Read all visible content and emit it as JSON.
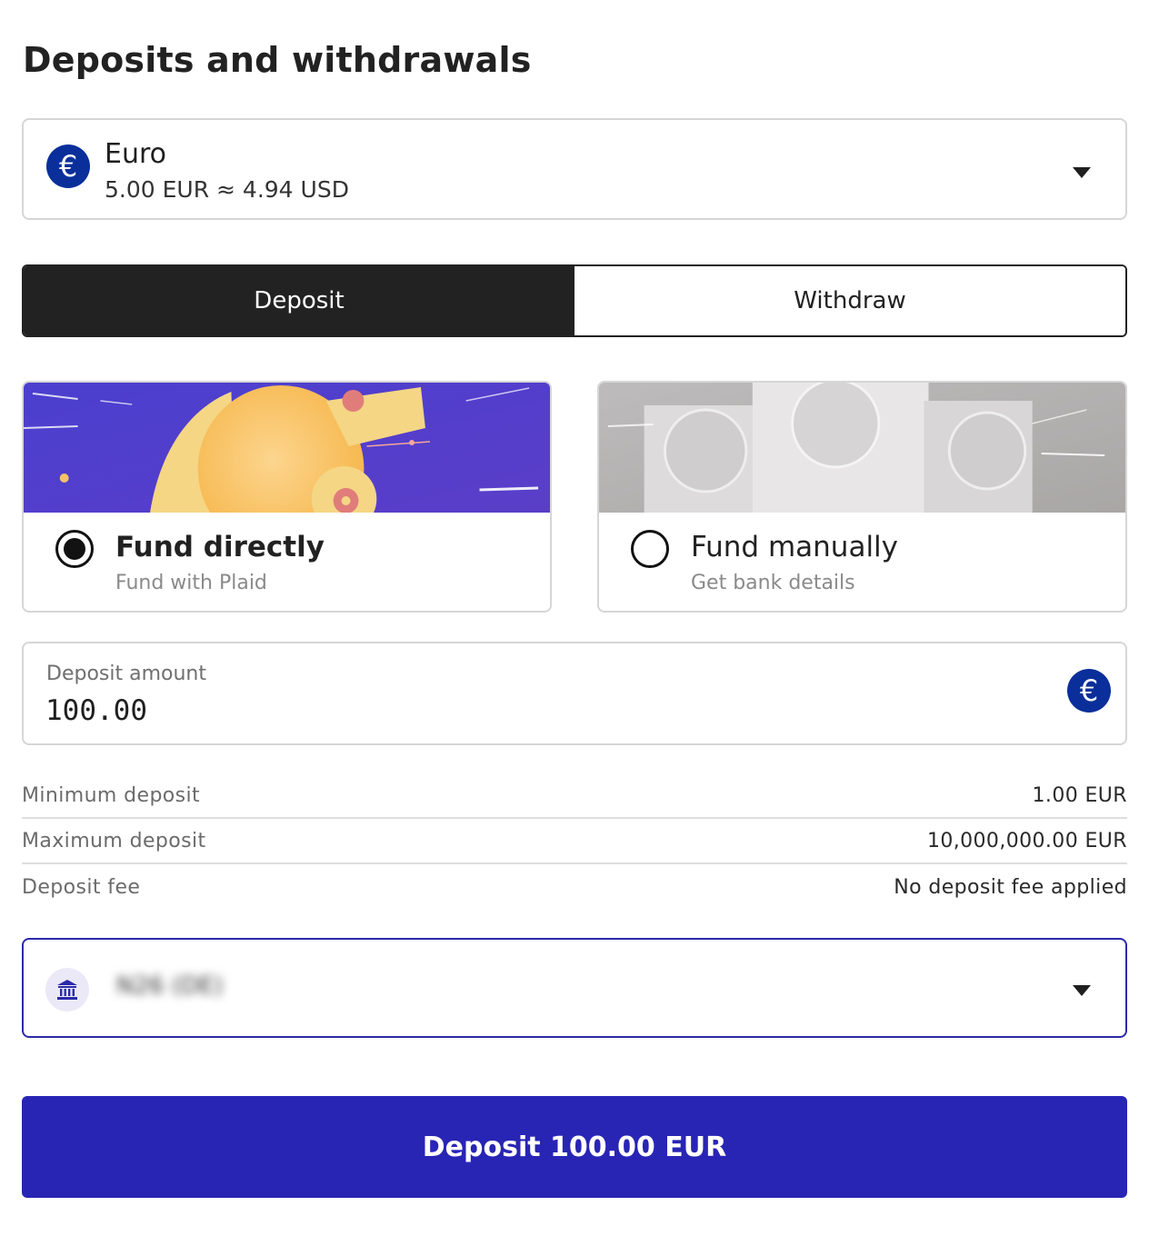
{
  "page": {
    "title": "Deposits and withdrawals"
  },
  "currency": {
    "icon": "euro-icon",
    "symbol": "€",
    "name": "Euro",
    "balance": "5.00 EUR ≈ 4.94 USD",
    "badge_color": "#0a2f9a"
  },
  "tabs": [
    {
      "label": "Deposit",
      "active": true
    },
    {
      "label": "Withdraw",
      "active": false
    }
  ],
  "funding_options": [
    {
      "title": "Fund directly",
      "subtitle": "Fund with Plaid",
      "selected": true
    },
    {
      "title": "Fund manually",
      "subtitle": "Get bank details",
      "selected": false
    }
  ],
  "amount": {
    "label": "Deposit amount",
    "value": "100.00",
    "currency_symbol": "€"
  },
  "limits": [
    {
      "label": "Minimum deposit",
      "value": "1.00 EUR"
    },
    {
      "label": "Maximum deposit",
      "value": "10,000,000.00 EUR"
    },
    {
      "label": "Deposit fee",
      "value": "No deposit fee applied"
    }
  ],
  "bank": {
    "icon": "bank-icon",
    "name": "N26 (DE)",
    "blurred": true
  },
  "submit": {
    "label": "Deposit 100.00 EUR",
    "color": "#2825b5"
  }
}
